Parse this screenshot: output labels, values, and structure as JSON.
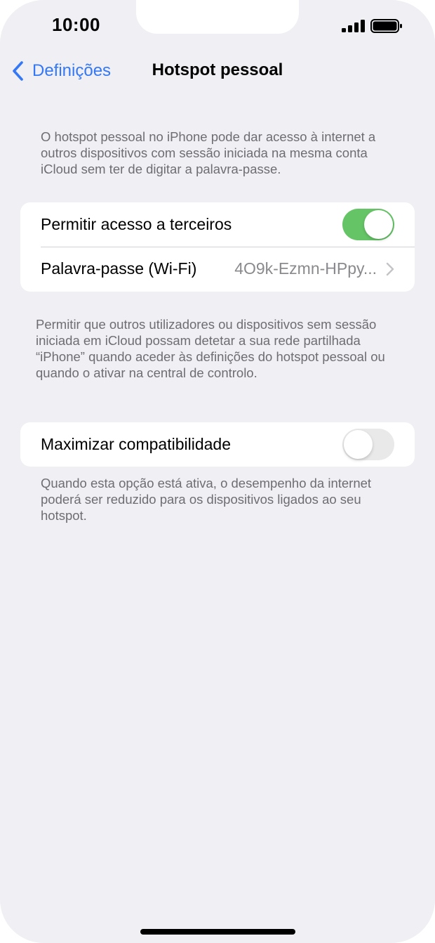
{
  "status_bar": {
    "time": "10:00",
    "signal_icon": "cellular-signal-icon",
    "battery_icon": "battery-full-icon"
  },
  "nav": {
    "back_label": "Definições",
    "back_icon": "chevron-left-icon",
    "title": "Hotspot pessoal"
  },
  "intro_text": "O hotspot pessoal no iPhone pode dar acesso à internet a outros dispositivos com sessão iniciada na mesma conta iCloud sem ter de digitar a palavra-passe.",
  "group1": {
    "allow_others": {
      "label": "Permitir acesso a terceiros",
      "enabled": true
    },
    "wifi_password": {
      "label": "Palavra-passe (Wi-Fi)",
      "value": "4O9k-Ezmn-HPpy..."
    }
  },
  "group1_footer": "Permitir que outros utilizadores ou dispositivos sem sessão iniciada em iCloud possam detetar a sua rede partilhada “iPhone” quando aceder às definições do hotspot pessoal ou quando o ativar na central de controlo.",
  "group2": {
    "maximize_compat": {
      "label": "Maximizar compatibilidade",
      "enabled": false
    }
  },
  "group2_footer": "Quando esta opção está ativa, o desempenho da internet poderá ser reduzido para os dispositivos ligados ao seu hotspot.",
  "colors": {
    "accent": "#3478f6",
    "toggle_on": "#65c466",
    "background": "#efeff4"
  }
}
